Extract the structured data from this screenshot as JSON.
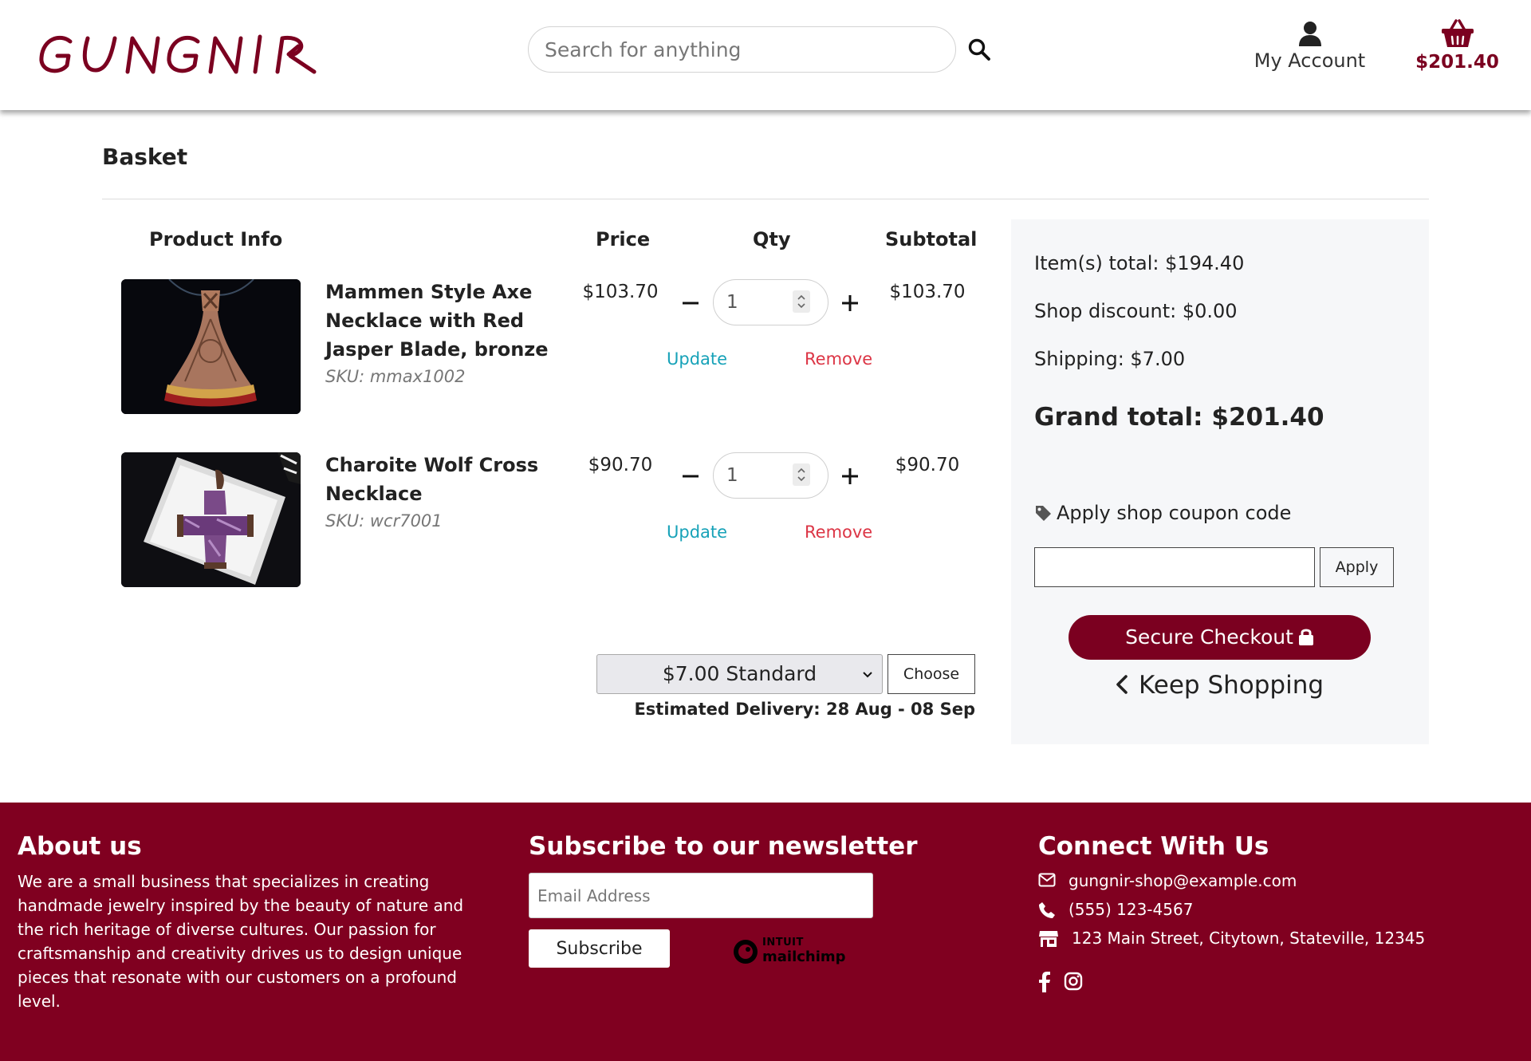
{
  "header": {
    "logo_text": "GUNGNIR",
    "search_placeholder": "Search for anything",
    "account_label": "My Account",
    "basket_total": "$201.40"
  },
  "basket": {
    "title": "Basket",
    "columns": {
      "product": "Product Info",
      "price": "Price",
      "qty": "Qty",
      "subtotal": "Subtotal"
    },
    "items": [
      {
        "name": "Mammen Style Axe Necklace with Red Jasper Blade, bronze",
        "sku": "SKU: mmax1002",
        "price": "$103.70",
        "qty": "1",
        "subtotal": "$103.70",
        "update_label": "Update",
        "remove_label": "Remove"
      },
      {
        "name": "Charoite Wolf Cross Necklace",
        "sku": "SKU: wcr7001",
        "price": "$90.70",
        "qty": "1",
        "subtotal": "$90.70",
        "update_label": "Update",
        "remove_label": "Remove"
      }
    ],
    "shipping_option": "$7.00 Standard",
    "choose_label": "Choose",
    "estimated_delivery": "Estimated Delivery: 28 Aug - 08 Sep"
  },
  "summary": {
    "items_total": "Item(s) total: $194.40",
    "shop_discount": "Shop discount: $0.00",
    "shipping": "Shipping: $7.00",
    "grand_total": "Grand total: $201.40",
    "coupon_label": "Apply shop coupon code",
    "coupon_value": "",
    "apply_label": "Apply",
    "checkout_label": "Secure Checkout",
    "keep_shopping_label": "Keep Shopping"
  },
  "footer": {
    "about_heading": "About us",
    "about_text": "We are a small business that specializes in creating handmade jewelry inspired by the beauty of nature and the rich heritage of diverse cultures. Our passion for craftsmanship and creativity drives us to design unique pieces that resonate with our customers on a profound level.",
    "newsletter_heading": "Subscribe to our newsletter",
    "email_placeholder": "Email Address",
    "subscribe_label": "Subscribe",
    "mailchimp_top": "INTUIT",
    "mailchimp_word": "mailchimp",
    "connect_heading": "Connect With Us",
    "email": "gungnir-shop@example.com",
    "phone": "(555) 123-4567",
    "address": "123 Main Street, Citytown, Stateville, 12345"
  },
  "colors": {
    "brand": "#800020",
    "update_link": "#17a2b8",
    "remove_link": "#dc3545",
    "summary_bg": "#f6f7f9"
  },
  "icons": [
    "search-icon",
    "user-icon",
    "basket-icon",
    "minus-icon",
    "plus-icon",
    "tag-icon",
    "lock-icon",
    "chevron-left-icon",
    "envelope-icon",
    "phone-icon",
    "store-icon",
    "facebook-icon",
    "instagram-icon"
  ]
}
